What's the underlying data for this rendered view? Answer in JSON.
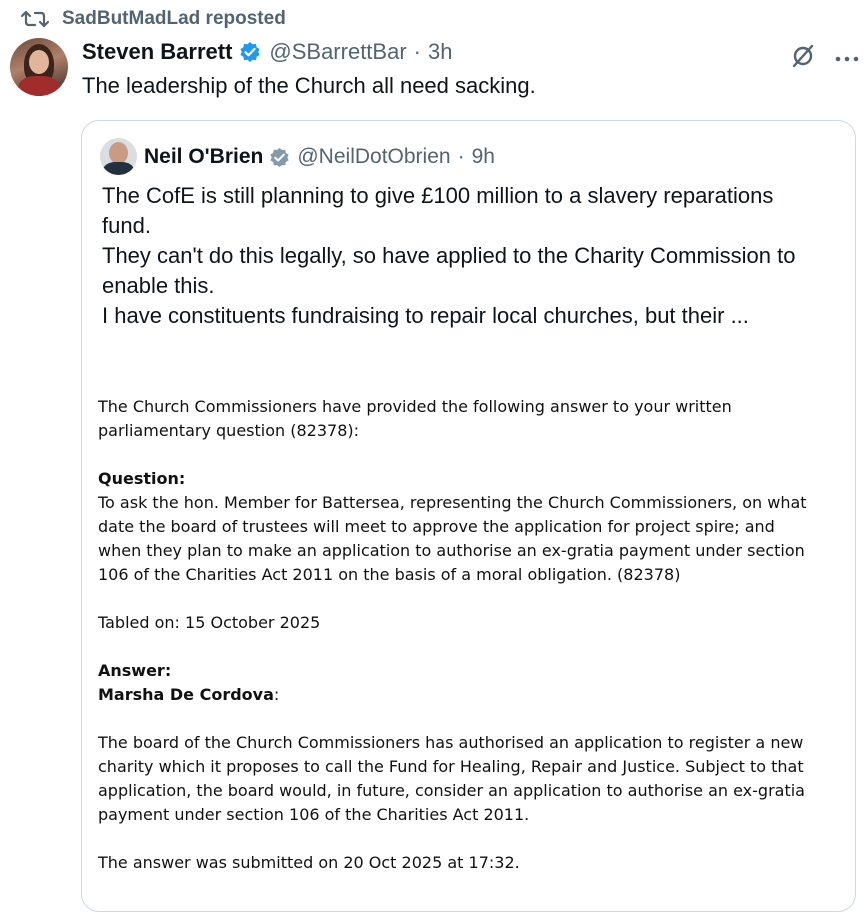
{
  "repost": {
    "label": "SadButMadLad reposted"
  },
  "tweet": {
    "author_name": "Steven Barrett",
    "handle": "@SBarrettBar",
    "separator": "·",
    "time": "3h",
    "text": "The leadership of the Church all need sacking."
  },
  "quote": {
    "author_name": "Neil O'Brien",
    "handle": "@NeilDotObrien",
    "separator": "·",
    "time": "9h",
    "text_lines": [
      "The CofE is still planning to give £100 million to a slavery reparations",
      "fund.",
      "They can't do this legally, so have applied to the Charity Commission to",
      "enable this.",
      "I have constituents fundraising to repair local churches, but their ..."
    ]
  },
  "document": {
    "intro": [
      "The Church Commissioners have provided the following answer to your written",
      "parliamentary question (82378):"
    ],
    "question_heading": "Question:",
    "question": [
      "To ask the hon. Member for Battersea, representing the Church Commissioners, on what",
      "date the board of trustees will meet to approve the application for project spire; and",
      "when they plan to make an application to authorise an ex-gratia payment under section",
      "106 of the Charities Act 2011 on the basis of a moral obligation. (82378)"
    ],
    "tabled": "Tabled on: 15 October 2025",
    "answer_heading": "Answer:",
    "answerer": "Marsha De Cordova",
    "answerer_suffix": ":",
    "answer": [
      "The board of the Church Commissioners has authorised an application to register a new",
      "charity which it proposes to call the Fund for Healing, Repair and Justice. Subject to that",
      "application, the board would, in future, consider an application to authorise an ex-gratia",
      "payment under section 106 of the Charities Act 2011."
    ],
    "submitted": "The answer was submitted on 20 Oct 2025 at 17:32."
  },
  "icons": {
    "repost": "repost-icon",
    "verified": "verified-badge-icon",
    "grok": "grok-icon",
    "more": "more-options-icon"
  },
  "colors": {
    "verified": "#1d9bf0",
    "secondary_text": "#536471",
    "border": "#cfd9de"
  }
}
